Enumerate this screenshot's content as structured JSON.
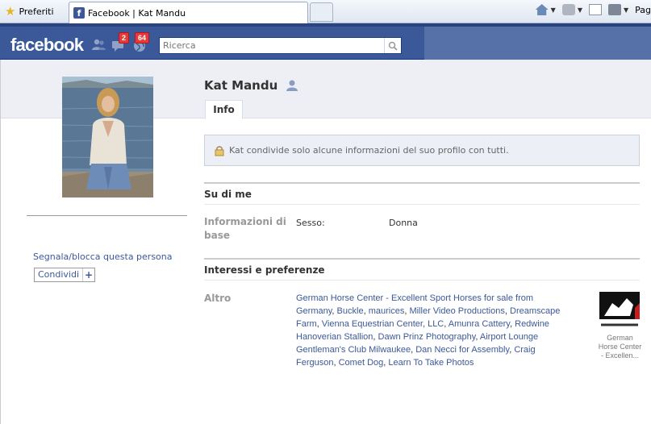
{
  "browser": {
    "favorites_label": "Preferiti",
    "tab_title": "Facebook | Kat Mandu",
    "page_menu_label": "Pag"
  },
  "header": {
    "logo": "facebook",
    "message_count": "2",
    "notification_count": "64",
    "search_placeholder": "Ricerca"
  },
  "profile": {
    "name": "Kat Mandu",
    "tab_info": "Info",
    "privacy_notice": "Kat condivide solo alcune informazioni del suo profilo con tutti.",
    "report_link": "Segnala/blocca questa persona",
    "share_label": "Condividi",
    "share_plus": "+"
  },
  "about": {
    "heading": "Su di me",
    "basic_label": "Informazioni di base",
    "sex_key": "Sesso:",
    "sex_value": "Donna"
  },
  "interests": {
    "heading": "Interessi e preferenze",
    "other_label": "Altro",
    "items": [
      "German Horse Center - Excellent Sport Horses for sale from Germany",
      "Buckle",
      "maurices",
      "Miller Video Productions",
      "Dreamscape Farm",
      "Vienna Equestrian Center, LLC",
      "Amunra Cattery",
      "Redwine Hanoverian Stallion",
      "Dawn Prinz Photography",
      "Airport Lounge Gentleman's Club Milwaukee",
      "Dan Necci for Assembly",
      "Craig Ferguson",
      "Comet Dog",
      "Learn To Take Photos"
    ],
    "thumb_caption": "German Horse Center - Excellen..."
  }
}
